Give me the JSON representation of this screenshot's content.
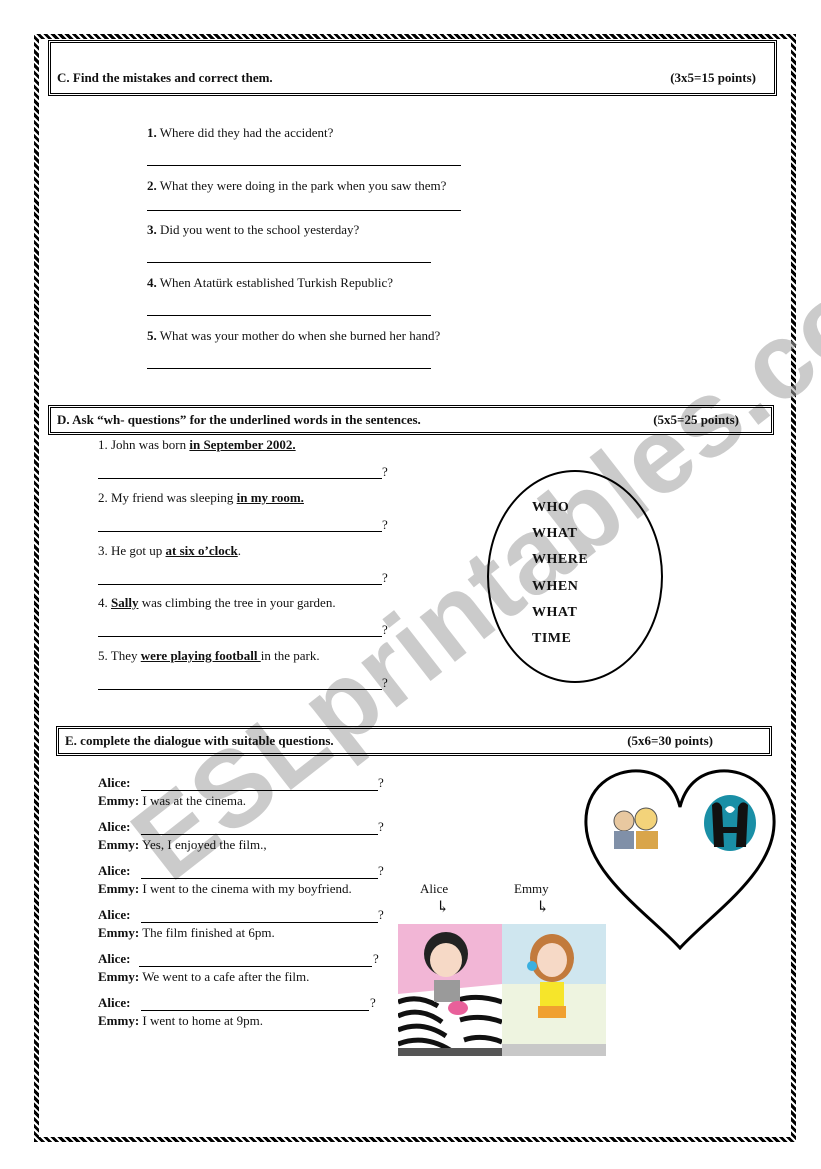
{
  "watermark": "ESLprintables.com",
  "section_c": {
    "title": "C. Find the mistakes and correct them.",
    "points": "(3x5=15 points)",
    "items": [
      {
        "num": "1.",
        "text": "Where did they had the accident?"
      },
      {
        "num": "2.",
        "text": "What  they were doing in the park when you saw them?"
      },
      {
        "num": "3.",
        "text": "Did you went to the school yesterday?"
      },
      {
        "num": "4.",
        "text": "When Atatürk established Turkish Republic?"
      },
      {
        "num": "5.",
        "text": "What was your mother do when she burned her hand?"
      }
    ]
  },
  "section_d": {
    "title": "D. Ask “wh- questions” for the underlined words in the sentences.",
    "points": "(5x5=25 points)",
    "items": [
      {
        "pre": "1. John was born ",
        "underlined": "in September 2002.",
        "post": ""
      },
      {
        "pre": "2. My friend was sleeping ",
        "underlined": "in my room.",
        "post": ""
      },
      {
        "pre": "3. He got up ",
        "underlined": "at six o’clock",
        "post": "."
      },
      {
        "pre": "4.  ",
        "underlined": "Sally",
        "post": " was climbing the tree in your garden."
      },
      {
        "pre": "5. They ",
        "underlined": "were playing football ",
        "post": "  in the park."
      }
    ],
    "answer_suffix": "?",
    "wh_words": [
      "WHO",
      "WHAT",
      "WHERE",
      "WHEN",
      "WHAT",
      "TIME"
    ]
  },
  "section_e": {
    "title": "E. complete the dialogue with suitable questions.",
    "points": "(5x6=30 points)",
    "speaker_a": "Alice:",
    "speaker_b": "Emmy:",
    "answer_suffix": "?",
    "replies": [
      "I was at the cinema.",
      "Yes, I enjoyed the film.,",
      "I went to the cinema with my boyfriend.",
      "The film finished at 6pm.",
      "We went to a cafe after the film.",
      "I went to home at 9pm."
    ],
    "picture_labels": {
      "left": "Alice",
      "right": "Emmy"
    },
    "arrow_glyph": "↳"
  }
}
